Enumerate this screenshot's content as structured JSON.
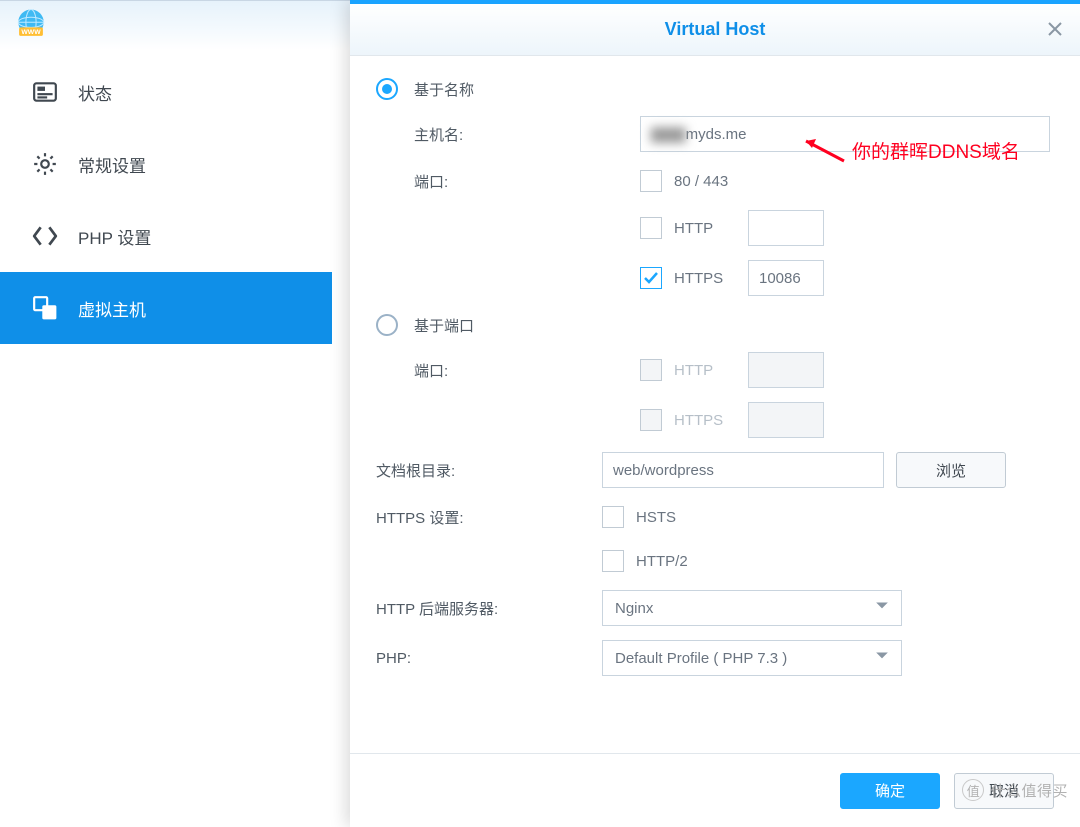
{
  "sidebar": {
    "items": [
      {
        "icon": "status",
        "label": "状态"
      },
      {
        "icon": "gear",
        "label": "常规设置"
      },
      {
        "icon": "php",
        "label": "PHP 设置"
      },
      {
        "icon": "vhost",
        "label": "虚拟主机"
      }
    ],
    "active_index": 3
  },
  "modal": {
    "title": "Virtual Host",
    "ok_label": "确定",
    "cancel_label": "取消"
  },
  "form": {
    "mode_name_label": "基于名称",
    "mode_port_label": "基于端口",
    "mode": "name",
    "hostname_label": "主机名:",
    "hostname_masked": "▇▇▇",
    "hostname_suffix": "myds.me",
    "hostname_full_display": "▇▇▇myds.me",
    "port_label": "端口:",
    "port_80443_checked": false,
    "port_80443_text": "80 / 443",
    "http_checked": false,
    "http_text": "HTTP",
    "http_port": "",
    "https_checked": true,
    "https_text": "HTTPS",
    "https_port": "10086",
    "port_mode_http_text": "HTTP",
    "port_mode_https_text": "HTTPS",
    "docroot_label": "文档根目录:",
    "docroot_value": "web/wordpress",
    "browse_label": "浏览",
    "https_settings_label": "HTTPS 设置:",
    "hsts_checked": false,
    "hsts_text": "HSTS",
    "http2_checked": false,
    "http2_text": "HTTP/2",
    "backend_label": "HTTP 后端服务器:",
    "backend_value": "Nginx",
    "php_label": "PHP:",
    "php_value": "Default Profile ( PHP 7.3 )"
  },
  "annotation": {
    "text": "你的群晖DDNS域名"
  },
  "watermark": "什么值得买"
}
